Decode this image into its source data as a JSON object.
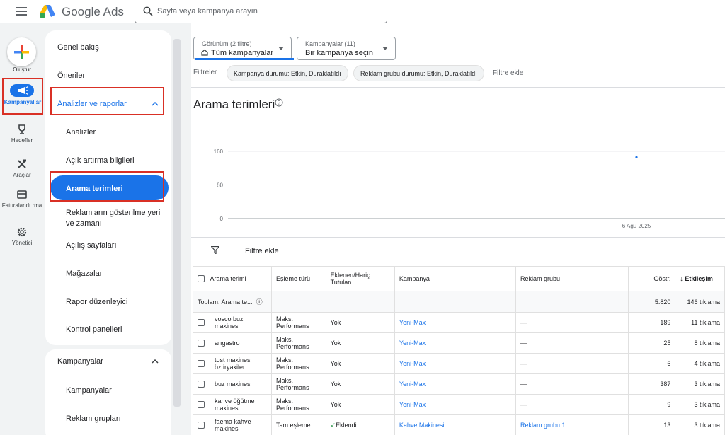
{
  "header": {
    "brand": "Google Ads",
    "search_placeholder": "Sayfa veya kampanya arayın"
  },
  "rail": {
    "create": "Oluştur",
    "campaigns": "Kampanyal ar",
    "goals": "Hedefler",
    "tools": "Araçlar",
    "billing": "Faturalandı rma",
    "admin": "Yönetici"
  },
  "nav": {
    "overview": "Genel bakış",
    "recommendations": "Öneriler",
    "insights_reports": "Analizler ve raporlar",
    "sub": {
      "insights": "Analizler",
      "auction": "Açık artırma bilgileri",
      "search_terms": "Arama terimleri",
      "where_when": "Reklamların gösterilme yeri ve zamanı",
      "landing": "Açılış sayfaları",
      "stores": "Mağazalar",
      "report_editor": "Rapor düzenleyici",
      "dashboards": "Kontrol panelleri"
    },
    "campaigns_section": "Kampanyalar",
    "campaigns_sub": {
      "campaigns": "Kampanyalar",
      "ad_groups": "Reklam grupları"
    }
  },
  "filters": {
    "view_small": "Görünüm (2 filtre)",
    "view_value": "Tüm kampanyalar",
    "campaign_small": "Kampanyalar (11)",
    "campaign_value": "Bir kampanya seçin",
    "label": "Filtreler",
    "chip1": "Kampanya durumu: Etkin, Duraklatıldı",
    "chip2": "Reklam grubu durumu: Etkin, Duraklatıldı",
    "add": "Filtre ekle"
  },
  "page": {
    "title": "Arama terimleri",
    "add_filter": "Filtre ekle"
  },
  "chart_data": {
    "type": "scatter",
    "y_ticks": [
      "160",
      "80",
      "0"
    ],
    "ylim": [
      0,
      160
    ],
    "x_label_tick": "6 Ağu 2025",
    "points": [
      {
        "x": "6 Ağu 2025",
        "y": 146
      }
    ],
    "grid": true
  },
  "table": {
    "headers": [
      "Arama terimi",
      "Eşleme türü",
      "Eklenen/Hariç Tutulan",
      "Kampanya",
      "Reklam grubu",
      "Göstr.",
      "Etkileşim"
    ],
    "total": {
      "label": "Toplam: Arama te...",
      "impressions": "5.820",
      "interactions": "146 tıklama"
    },
    "rows": [
      {
        "term": "vosco buz makinesi",
        "match": "Maks. Performans",
        "added": "Yok",
        "campaign": "Yeni-Max",
        "adgroup": "—",
        "impr": "189",
        "inter": "11 tıklama"
      },
      {
        "term": "arıgastro",
        "match": "Maks. Performans",
        "added": "Yok",
        "campaign": "Yeni-Max",
        "adgroup": "—",
        "impr": "25",
        "inter": "8 tıklama"
      },
      {
        "term": "tost makinesi öztiryakiler",
        "match": "Maks. Performans",
        "added": "Yok",
        "campaign": "Yeni-Max",
        "adgroup": "—",
        "impr": "6",
        "inter": "4 tıklama"
      },
      {
        "term": "buz makinesi",
        "match": "Maks. Performans",
        "added": "Yok",
        "campaign": "Yeni-Max",
        "adgroup": "—",
        "impr": "387",
        "inter": "3 tıklama"
      },
      {
        "term": "kahve öğütme makinesi",
        "match": "Maks. Performans",
        "added": "Yok",
        "campaign": "Yeni-Max",
        "adgroup": "—",
        "impr": "9",
        "inter": "3 tıklama"
      },
      {
        "term": "faema kahve makinesi",
        "match": "Tam eşleme",
        "added": "Eklendi",
        "campaign": "Kahve Makinesi",
        "adgroup": "Reklam grubu 1",
        "impr": "13",
        "inter": "3 tıklama"
      }
    ]
  }
}
